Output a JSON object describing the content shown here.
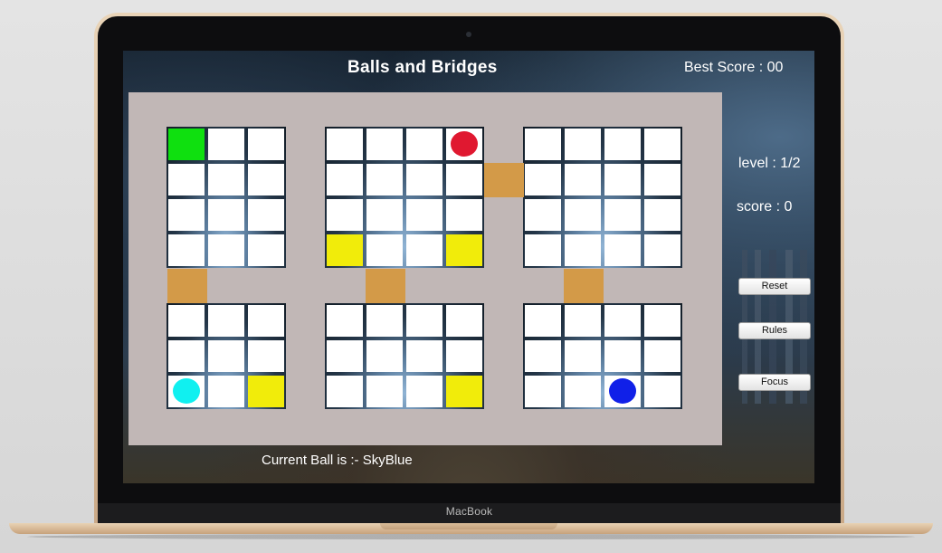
{
  "app": {
    "title": "Balls and Bridges",
    "best_score": "Best Score : 00",
    "level": "level : 1/2",
    "score": "score : 0",
    "current_ball": "Current Ball is :- SkyBlue"
  },
  "buttons": {
    "reset": "Reset",
    "rules": "Rules",
    "focus": "Focus"
  },
  "device": {
    "brand": "MacBook"
  },
  "colors": {
    "start_tile": "#0fe00f",
    "goal_tile": "#f1ec0a",
    "bridge": "#d39a48",
    "board": "#c1b7b6",
    "ball_red": "#e01830",
    "ball_skyblue": "#10f0f0",
    "ball_blue": "#1020e8"
  },
  "grids": [
    {
      "id": "top-left",
      "rows": 4,
      "cols": 3,
      "cells": [
        "green",
        "empty",
        "empty",
        "empty",
        "empty",
        "empty",
        "empty",
        "empty",
        "empty",
        "empty",
        "empty",
        "empty"
      ]
    },
    {
      "id": "top-middle",
      "rows": 4,
      "cols": 4,
      "cells": [
        "empty",
        "empty",
        "empty",
        "ball:red",
        "empty",
        "empty",
        "empty",
        "empty",
        "empty",
        "empty",
        "empty",
        "empty",
        "yellow",
        "empty",
        "empty",
        "yellow"
      ]
    },
    {
      "id": "top-right",
      "rows": 4,
      "cols": 4,
      "cells": [
        "empty",
        "empty",
        "empty",
        "empty",
        "empty",
        "empty",
        "empty",
        "empty",
        "empty",
        "empty",
        "empty",
        "empty",
        "empty",
        "empty",
        "empty",
        "empty"
      ]
    },
    {
      "id": "bottom-left",
      "rows": 3,
      "cols": 3,
      "cells": [
        "empty",
        "empty",
        "empty",
        "empty",
        "empty",
        "empty",
        "ball:skyblue",
        "empty",
        "yellow"
      ]
    },
    {
      "id": "bottom-middle",
      "rows": 3,
      "cols": 4,
      "cells": [
        "empty",
        "empty",
        "empty",
        "empty",
        "empty",
        "empty",
        "empty",
        "empty",
        "empty",
        "empty",
        "empty",
        "yellow"
      ]
    },
    {
      "id": "bottom-right",
      "rows": 3,
      "cols": 4,
      "cells": [
        "empty",
        "empty",
        "empty",
        "empty",
        "empty",
        "empty",
        "empty",
        "empty",
        "empty",
        "empty",
        "ball:blue",
        "empty"
      ]
    }
  ],
  "bridges": [
    "top-middle-to-top-right",
    "top-left-to-bottom-left",
    "top-middle-to-bottom-middle",
    "top-right-to-bottom-right"
  ]
}
